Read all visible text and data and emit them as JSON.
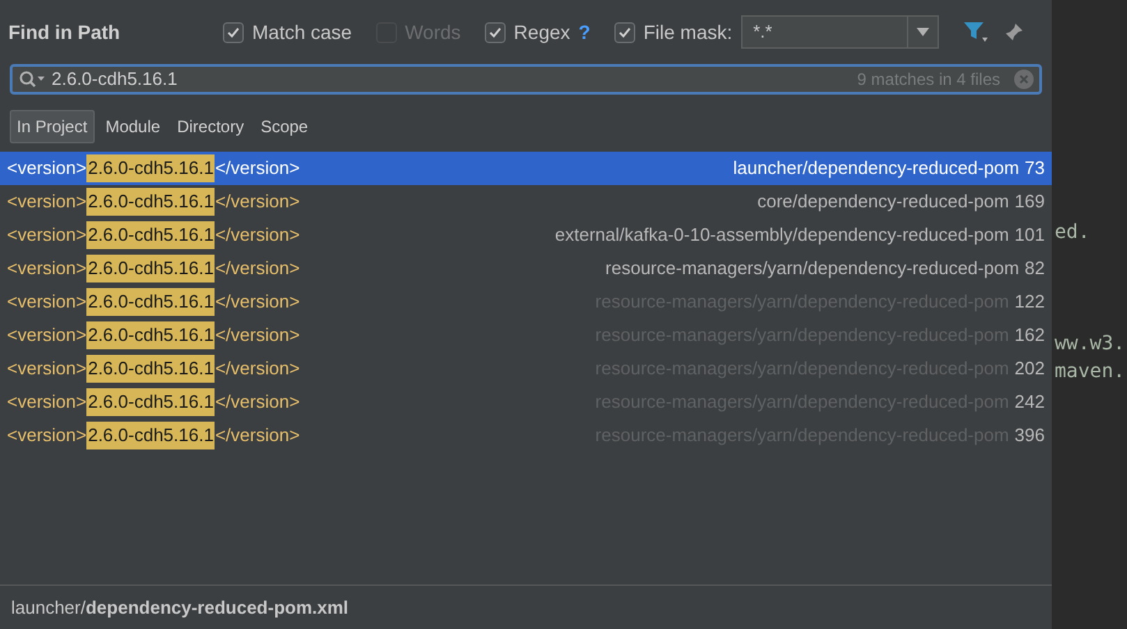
{
  "dialog": {
    "title": "Find in Path",
    "options": [
      {
        "label": "Match case",
        "checked": true,
        "disabled": false
      },
      {
        "label": "Words",
        "checked": false,
        "disabled": true
      },
      {
        "label": "Regex",
        "checked": true,
        "disabled": false,
        "help": "?"
      },
      {
        "label": "File mask:",
        "checked": true,
        "disabled": false
      }
    ],
    "file_mask": "*.*",
    "search": {
      "value": "2.6.0-cdh5.16.1",
      "count": "9 matches in 4 files"
    },
    "scopes": [
      {
        "label": "In Project",
        "selected": true
      },
      {
        "label": "Module",
        "selected": false
      },
      {
        "label": "Directory",
        "selected": false
      },
      {
        "label": "Scope",
        "selected": false
      }
    ],
    "results": [
      {
        "before": "<version>",
        "match": "2.6.0-cdh5.16.1",
        "after": "</version>",
        "path": "launcher/dependency-reduced-pom",
        "line": "73",
        "selected": true,
        "dimmed": false
      },
      {
        "before": "<version>",
        "match": "2.6.0-cdh5.16.1",
        "after": "</version>",
        "path": "core/dependency-reduced-pom",
        "line": "169",
        "selected": false,
        "dimmed": false
      },
      {
        "before": "<version>",
        "match": "2.6.0-cdh5.16.1",
        "after": "</version>",
        "path": "external/kafka-0-10-assembly/dependency-reduced-pom",
        "line": "101",
        "selected": false,
        "dimmed": false
      },
      {
        "before": "<version>",
        "match": "2.6.0-cdh5.16.1",
        "after": "</version>",
        "path": "resource-managers/yarn/dependency-reduced-pom",
        "line": "82",
        "selected": false,
        "dimmed": false
      },
      {
        "before": "<version>",
        "match": "2.6.0-cdh5.16.1",
        "after": "</version>",
        "path": "resource-managers/yarn/dependency-reduced-pom",
        "line": "122",
        "selected": false,
        "dimmed": true
      },
      {
        "before": "<version>",
        "match": "2.6.0-cdh5.16.1",
        "after": "</version>",
        "path": "resource-managers/yarn/dependency-reduced-pom",
        "line": "162",
        "selected": false,
        "dimmed": true
      },
      {
        "before": "<version>",
        "match": "2.6.0-cdh5.16.1",
        "after": "</version>",
        "path": "resource-managers/yarn/dependency-reduced-pom",
        "line": "202",
        "selected": false,
        "dimmed": true
      },
      {
        "before": "<version>",
        "match": "2.6.0-cdh5.16.1",
        "after": "</version>",
        "path": "resource-managers/yarn/dependency-reduced-pom",
        "line": "242",
        "selected": false,
        "dimmed": true
      },
      {
        "before": "<version>",
        "match": "2.6.0-cdh5.16.1",
        "after": "</version>",
        "path": "resource-managers/yarn/dependency-reduced-pom",
        "line": "396",
        "selected": false,
        "dimmed": true
      }
    ],
    "footer": "launcher/**dependency-reduced-pom.xml**"
  },
  "editor_fragments": [
    {
      "text": "ed."
    },
    {
      "text": "ww.w3."
    },
    {
      "text": "maven."
    }
  ]
}
